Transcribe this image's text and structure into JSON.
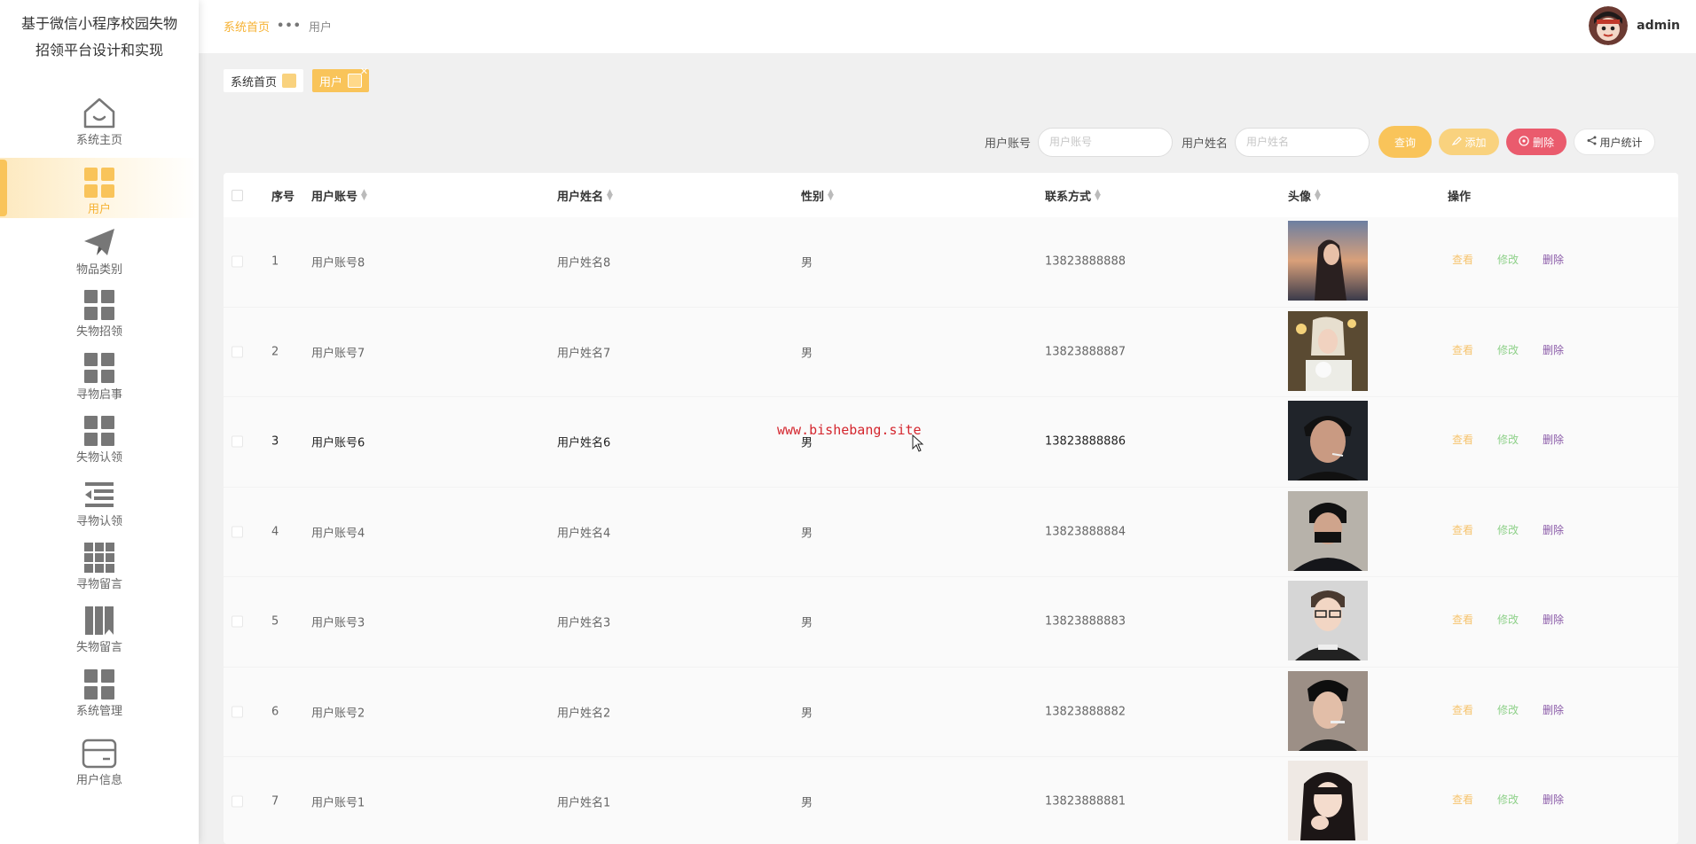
{
  "app": {
    "title": "基于微信小程序校园失物招领平台设计和实现",
    "title_line1": "基于微信小程序校园失物",
    "title_line2": "招领平台设计和实现"
  },
  "sidebar": {
    "items": [
      {
        "label": "系统主页",
        "icon": "home-icon",
        "active": false
      },
      {
        "label": "用户",
        "icon": "grid-icon",
        "active": true
      },
      {
        "label": "物品类别",
        "icon": "paper-plane-icon",
        "active": false
      },
      {
        "label": "失物招领",
        "icon": "grid-icon",
        "active": false
      },
      {
        "label": "寻物启事",
        "icon": "grid-icon",
        "active": false
      },
      {
        "label": "失物认领",
        "icon": "grid-icon",
        "active": false
      },
      {
        "label": "寻物认领",
        "icon": "list-indent-icon",
        "active": false
      },
      {
        "label": "寻物留言",
        "icon": "grid-9-icon",
        "active": false
      },
      {
        "label": "失物留言",
        "icon": "books-icon",
        "active": false
      },
      {
        "label": "系统管理",
        "icon": "grid-icon",
        "active": false
      },
      {
        "label": "用户信息",
        "icon": "card-icon",
        "active": false
      }
    ]
  },
  "header": {
    "breadcrumb_home": "系统首页",
    "breadcrumb_sep": "•••",
    "breadcrumb_current": "用户",
    "username": "admin"
  },
  "tabs": [
    {
      "label": "系统首页",
      "active": false
    },
    {
      "label": "用户",
      "active": true
    }
  ],
  "search": {
    "account_label": "用户账号",
    "account_placeholder": "用户账号",
    "name_label": "用户姓名",
    "name_placeholder": "用户姓名",
    "search_button": "查询",
    "add_button": "添加",
    "delete_button": "删除",
    "stat_button": "用户统计"
  },
  "table": {
    "columns": {
      "index": "序号",
      "account": "用户账号",
      "name": "用户姓名",
      "gender": "性别",
      "phone": "联系方式",
      "avatar": "头像",
      "actions": "操作"
    },
    "action_labels": {
      "view": "查看",
      "edit": "修改",
      "delete": "删除"
    },
    "rows": [
      {
        "index": "1",
        "account": "用户账号8",
        "name": "用户姓名8",
        "gender": "男",
        "phone": "13823888888"
      },
      {
        "index": "2",
        "account": "用户账号7",
        "name": "用户姓名7",
        "gender": "男",
        "phone": "13823888887"
      },
      {
        "index": "3",
        "account": "用户账号6",
        "name": "用户姓名6",
        "gender": "男",
        "phone": "13823888886"
      },
      {
        "index": "4",
        "account": "用户账号4",
        "name": "用户姓名4",
        "gender": "男",
        "phone": "13823888884"
      },
      {
        "index": "5",
        "account": "用户账号3",
        "name": "用户姓名3",
        "gender": "男",
        "phone": "13823888883"
      },
      {
        "index": "6",
        "account": "用户账号2",
        "name": "用户姓名2",
        "gender": "男",
        "phone": "13823888882"
      },
      {
        "index": "7",
        "account": "用户账号1",
        "name": "用户姓名1",
        "gender": "男",
        "phone": "13823888881"
      }
    ]
  },
  "watermark": "www.bishebang.site",
  "colors": {
    "accent": "#f9c45a",
    "danger": "#ea5b6d",
    "view": "#f6c46f",
    "edit": "#8fd18a",
    "delete": "#8a5aa8"
  }
}
